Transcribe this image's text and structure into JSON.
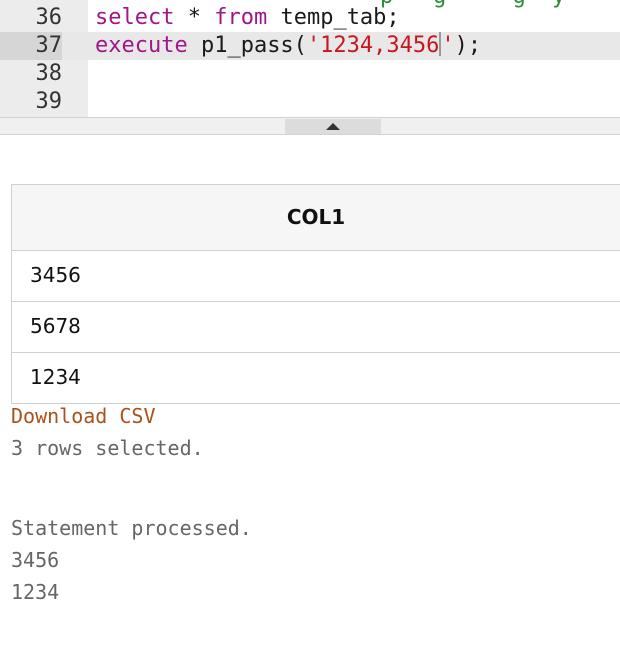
{
  "editor": {
    "partial_top_text": "p   g     g  y",
    "lines": [
      {
        "number": "36",
        "kw1": "select",
        "mid": " * ",
        "kw2": "from",
        "rest": " temp_tab;"
      },
      {
        "number": "37",
        "kw1": "execute",
        "mid": " p1_pass(",
        "str1": "'1234,3456",
        "str2": "'",
        "rest": ");"
      },
      {
        "number": "38"
      },
      {
        "number": "39"
      }
    ]
  },
  "results": {
    "columns": [
      "COL1"
    ],
    "rows": [
      [
        "3456"
      ],
      [
        "5678"
      ],
      [
        "1234"
      ]
    ],
    "download_label": "Download CSV",
    "summary": "3 rows selected."
  },
  "output": {
    "statement": "Statement processed.",
    "lines": [
      "3456",
      "1234"
    ]
  },
  "colors": {
    "keyword": "#a0168c",
    "string": "#c8161d",
    "comment": "#2e8b3a",
    "link": "#a8521c"
  }
}
